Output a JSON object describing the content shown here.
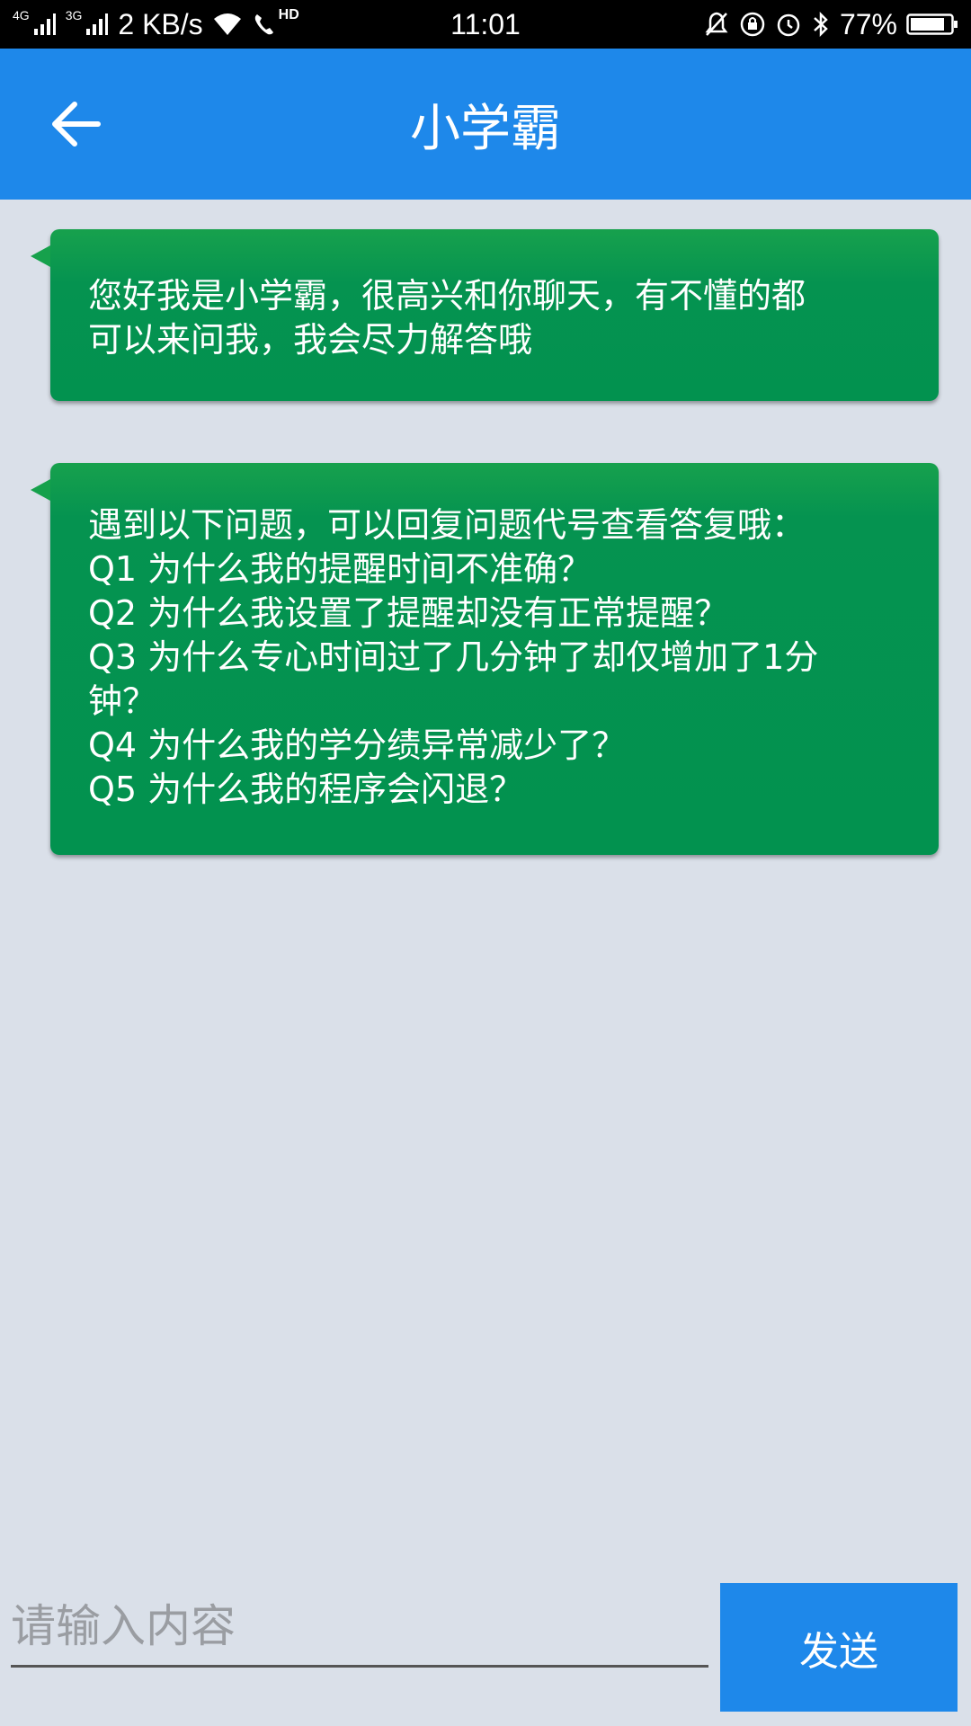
{
  "status_bar": {
    "net1": "4G",
    "net2": "3G",
    "speed": "2 KB/s",
    "hd": "HD",
    "time": "11:01",
    "battery": "77%",
    "icons": [
      "signal-icon",
      "wifi-icon",
      "hd-call-icon",
      "mute-icon",
      "rotation-lock-icon",
      "alarm-icon",
      "bluetooth-icon",
      "battery-icon"
    ]
  },
  "app_bar": {
    "title": "小学霸",
    "back_icon": "arrow-left-icon"
  },
  "messages": [
    {
      "lines": [
        "您好我是小学霸，很高兴和你聊天，有不懂的都",
        "可以来问我，我会尽力解答哦"
      ]
    },
    {
      "lines": [
        "遇到以下问题，可以回复问题代号查看答复哦：",
        "Q1 为什么我的提醒时间不准确？",
        "Q2 为什么我设置了提醒却没有正常提醒？",
        "Q3 为什么专心时间过了几分钟了却仅增加了1分",
        "钟？",
        "Q4 为什么我的学分绩异常减少了？",
        "Q5 为什么我的程序会闪退？"
      ]
    }
  ],
  "input": {
    "placeholder": "请输入内容",
    "value": ""
  },
  "send_label": "发送",
  "colors": {
    "app_bar": "#1e88ea",
    "bubble": "#059350",
    "background": "#dae0e9"
  }
}
